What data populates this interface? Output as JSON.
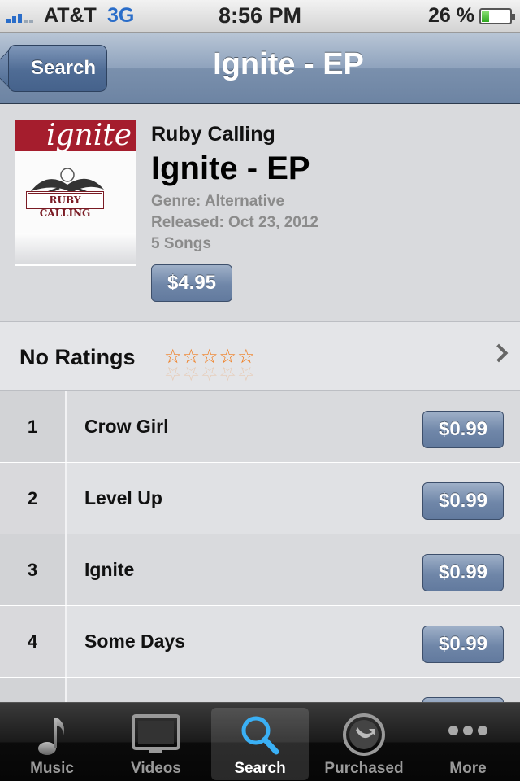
{
  "status_bar": {
    "carrier": "AT&T",
    "network": "3G",
    "time": "8:56 PM",
    "battery_percent": "26 %",
    "battery_level": 0.26
  },
  "nav": {
    "back_label": "Search",
    "title": "Ignite - EP"
  },
  "album": {
    "artwork_text": "ignite",
    "artwork_label": "RUBY CALLING",
    "artist": "Ruby Calling",
    "title": "Ignite - EP",
    "genre": "Genre: Alternative",
    "released": "Released: Oct 23, 2012",
    "song_count": "5 Songs",
    "price": "$4.95"
  },
  "ratings": {
    "label": "No Ratings",
    "stars": "☆☆☆☆☆",
    "stars_value": 0,
    "stars_max": 5
  },
  "songs": [
    {
      "number": "1",
      "title": "Crow Girl",
      "price": "$0.99"
    },
    {
      "number": "2",
      "title": "Level Up",
      "price": "$0.99"
    },
    {
      "number": "3",
      "title": "Ignite",
      "price": "$0.99"
    },
    {
      "number": "4",
      "title": "Some Days",
      "price": "$0.99"
    }
  ],
  "tabbar": {
    "tabs": [
      {
        "label": "Music",
        "icon": "music-note-icon"
      },
      {
        "label": "Videos",
        "icon": "tv-icon"
      },
      {
        "label": "Search",
        "icon": "search-icon",
        "active": true
      },
      {
        "label": "Purchased",
        "icon": "download-icon"
      },
      {
        "label": "More",
        "icon": "more-dots-icon"
      }
    ]
  },
  "colors": {
    "accent_blue": "#2a6dc9",
    "nav_bar": "#8fa3bd",
    "star_orange": "#f07a1a",
    "artwork_red": "#a51d2d"
  }
}
